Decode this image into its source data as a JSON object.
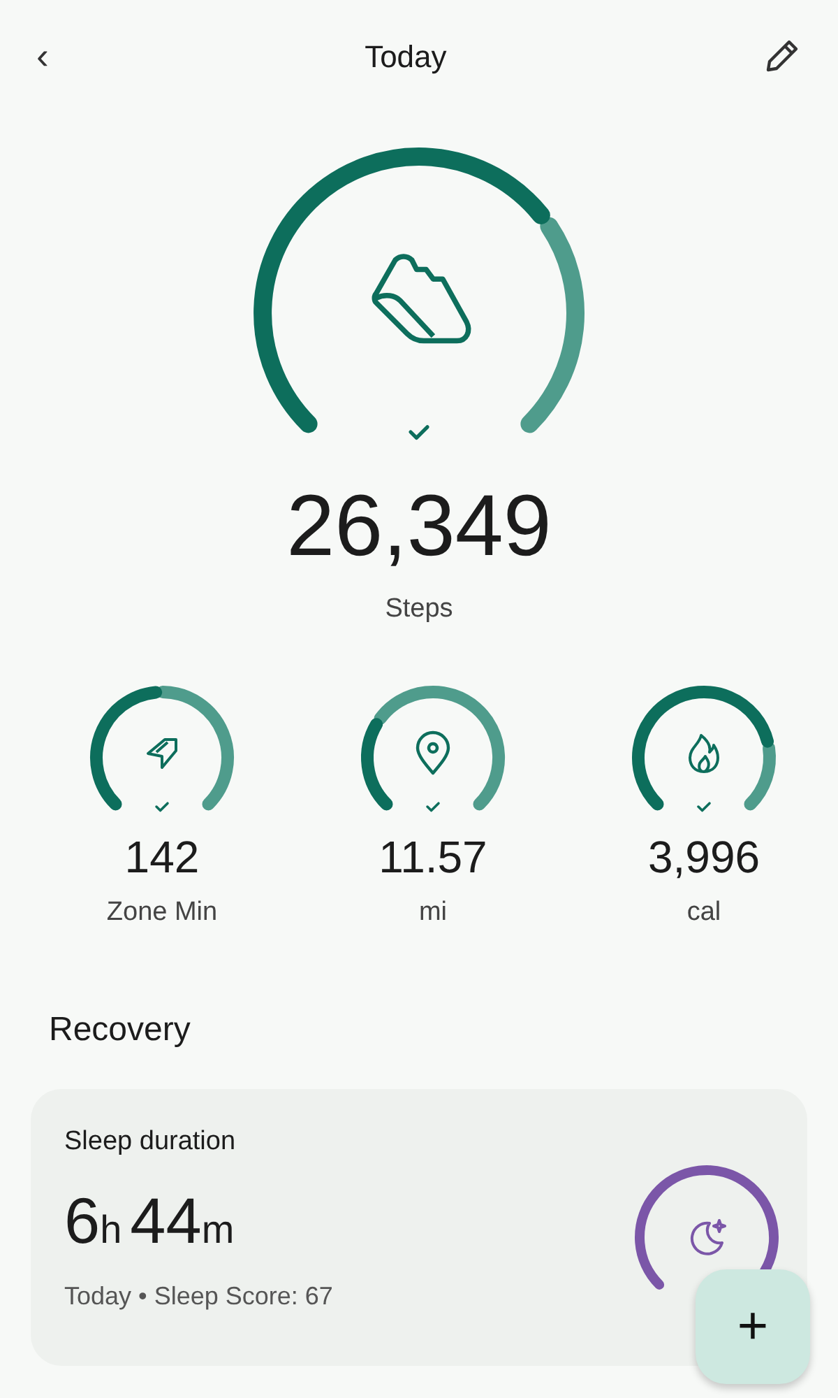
{
  "header": {
    "title": "Today",
    "back": "‹"
  },
  "main_metric": {
    "value": "26,349",
    "label": "Steps",
    "goal_met": true
  },
  "metrics": [
    {
      "kind": "zone",
      "value": "142",
      "label": "Zone Min",
      "goal_met": true
    },
    {
      "kind": "distance",
      "value": "11.57",
      "label": "mi",
      "goal_met": true
    },
    {
      "kind": "energy",
      "value": "3,996",
      "label": "cal",
      "goal_met": true
    }
  ],
  "section_title": "Recovery",
  "sleep_card": {
    "title": "Sleep duration",
    "duration": [
      {
        "number": "6",
        "unit": "h"
      },
      {
        "number": "44",
        "unit": "m"
      }
    ],
    "subtitle": "Today • Sleep Score: 67"
  },
  "fab": {
    "label": "+"
  }
}
